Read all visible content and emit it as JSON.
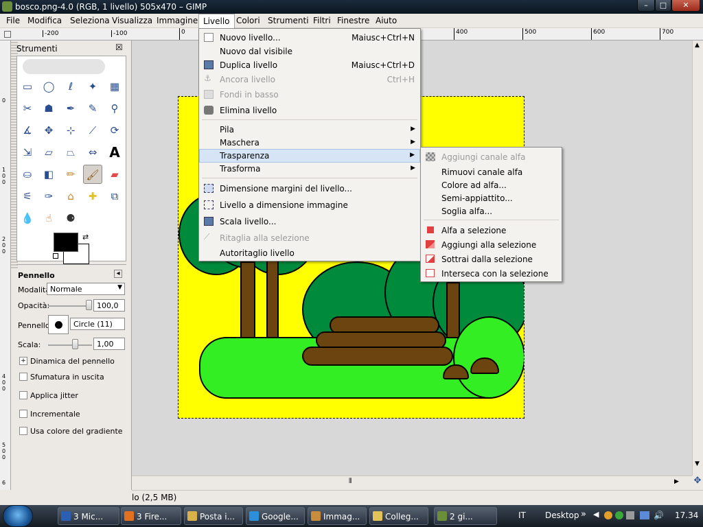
{
  "window": {
    "title": "bosco.png-4.0 (RGB, 1 livello) 505x470 – GIMP",
    "minimize": "–",
    "maximize": "□",
    "close": "✕"
  },
  "menubar": {
    "items": [
      "File",
      "Modifica",
      "Seleziona",
      "Visualizza",
      "Immagine",
      "Livello",
      "Colori",
      "Strumenti",
      "Filtri",
      "Finestre",
      "Aiuto"
    ],
    "active": "Livello"
  },
  "ruler": {
    "ticks": [
      "-200",
      "-100",
      "0",
      "400",
      "500",
      "600",
      "700"
    ],
    "vticks": [
      "0",
      "1 0 0",
      "2 0 0",
      "4 0 0",
      "5 0 0",
      "6"
    ]
  },
  "toolbox": {
    "title": "Strumenti",
    "close": "☒",
    "tool_options": {
      "title": "Pennello",
      "mode_label": "Modalità:",
      "mode_value": "Normale",
      "opacity_label": "Opacità:",
      "opacity_value": "100,0",
      "opacity_level": 1.0,
      "brush_label": "Pennello:",
      "brush_value": "Circle (11)",
      "scale_label": "Scala:",
      "scale_value": "1,00",
      "dynamics": "Dinamica del pennello",
      "fade_out": "Sfumatura in uscita",
      "jitter": "Applica jitter",
      "incremental": "Incrementale",
      "use_gradient": "Usa colore del gradiente"
    },
    "tools": [
      "rect-select-icon",
      "ellipse-select-icon",
      "free-select-icon",
      "fuzzy-select-icon",
      "by-color-select-icon",
      "scissors-icon",
      "foreground-select-icon",
      "paths-icon",
      "color-picker-icon",
      "zoom-icon",
      "measure-icon",
      "move-icon",
      "align-icon",
      "crop-icon",
      "rotate-icon",
      "scale-icon",
      "shear-icon",
      "perspective-icon",
      "flip-icon",
      "text-icon",
      "bucket-fill-icon",
      "blend-icon",
      "pencil-icon",
      "paintbrush-icon",
      "eraser-icon",
      "airbrush-icon",
      "ink-icon",
      "clone-icon",
      "heal-icon",
      "perspective-clone-icon",
      "smudge-icon",
      "blur-icon",
      "dodge-burn-icon"
    ],
    "fg_color": "#000000",
    "bg_color": "#ffffff"
  },
  "menu_livello": {
    "items": [
      {
        "label": "Nuovo livello...",
        "accel": "Maiusc+Ctrl+N",
        "disabled": false
      },
      {
        "label": "Nuovo dal visibile",
        "accel": "",
        "disabled": false
      },
      {
        "label": "Duplica livello",
        "accel": "Maiusc+Ctrl+D",
        "disabled": false
      },
      {
        "label": "Ancora livello",
        "accel": "Ctrl+H",
        "disabled": true
      },
      {
        "label": "Fondi in basso",
        "accel": "",
        "disabled": true
      },
      {
        "label": "Elimina livello",
        "accel": "",
        "disabled": false
      },
      {
        "label": "Pila",
        "submenu": true
      },
      {
        "label": "Maschera",
        "submenu": true
      },
      {
        "label": "Trasparenza",
        "submenu": true,
        "highlight": true
      },
      {
        "label": "Trasforma",
        "submenu": true
      },
      {
        "label": "Dimensione margini del livello...",
        "accel": "",
        "disabled": false
      },
      {
        "label": "Livello a dimensione immagine",
        "accel": "",
        "disabled": false
      },
      {
        "label": "Scala livello...",
        "accel": "",
        "disabled": false
      },
      {
        "label": "Ritaglia alla selezione",
        "accel": "",
        "disabled": true
      },
      {
        "label": "Autoritaglio livello",
        "accel": "",
        "disabled": false
      }
    ]
  },
  "menu_trasparenza": {
    "items": [
      {
        "label": "Aggiungi canale alfa",
        "disabled": true
      },
      {
        "label": "Rimuovi canale alfa",
        "disabled": false
      },
      {
        "label": "Colore ad alfa...",
        "disabled": false
      },
      {
        "label": "Semi-appiattito...",
        "disabled": false
      },
      {
        "label": "Soglia alfa...",
        "disabled": false
      },
      {
        "label": "Alfa a selezione",
        "disabled": false
      },
      {
        "label": "Aggiungi alla selezione",
        "disabled": false
      },
      {
        "label": "Sottrai dalla selezione",
        "disabled": false
      },
      {
        "label": "Interseca con la selezione",
        "disabled": false
      }
    ]
  },
  "statusbar": {
    "text": "lo (2,5 MB)"
  },
  "taskbar": {
    "buttons": [
      {
        "label": "3 Mic...",
        "color": "#2b5fb4"
      },
      {
        "label": "3 Fire...",
        "color": "#e2701f"
      },
      {
        "label": "Posta i...",
        "color": "#d9b24a"
      },
      {
        "label": "Google...",
        "color": "#2b8fd9"
      },
      {
        "label": "Immag...",
        "color": "#c88c3a"
      },
      {
        "label": "Colleg...",
        "color": "#e2c35a"
      },
      {
        "label": "2 gi...",
        "color": "#6b8e3a"
      }
    ],
    "lang": "IT",
    "desktop": "Desktop",
    "more": "»",
    "clock": "17.34"
  },
  "colors": {
    "image_bg": "#ffff00",
    "tree": "#008a3c",
    "grass": "#33ee22",
    "wood": "#6b4410"
  }
}
